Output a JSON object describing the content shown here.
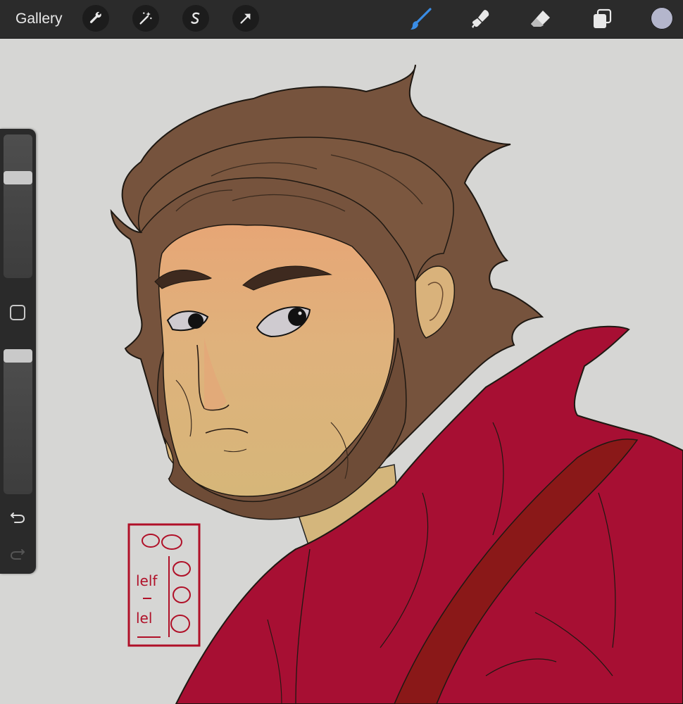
{
  "toolbar": {
    "gallery_label": "Gallery",
    "actions": [
      "wrench-icon",
      "magic-wand-icon",
      "selection-icon",
      "transform-arrow-icon"
    ],
    "tools": [
      "brush-icon",
      "smudge-icon",
      "eraser-icon",
      "layers-icon"
    ],
    "active_tool": "brush",
    "current_color": "#b4b6cc",
    "active_tool_color": "#3a8de6"
  },
  "sidebar": {
    "brush_size": 0.72,
    "opacity": 1.0,
    "modify_icon": "square-icon",
    "undo_icon": "undo-icon",
    "redo_icon": "redo-icon"
  },
  "artwork": {
    "signature_stamp": "lelf lel",
    "colors": {
      "background": "#d6d6d4",
      "hair": "#76533d",
      "skin": "#d9b27b",
      "robe": "#a70f33",
      "robe_shadow": "#8a1818"
    }
  }
}
